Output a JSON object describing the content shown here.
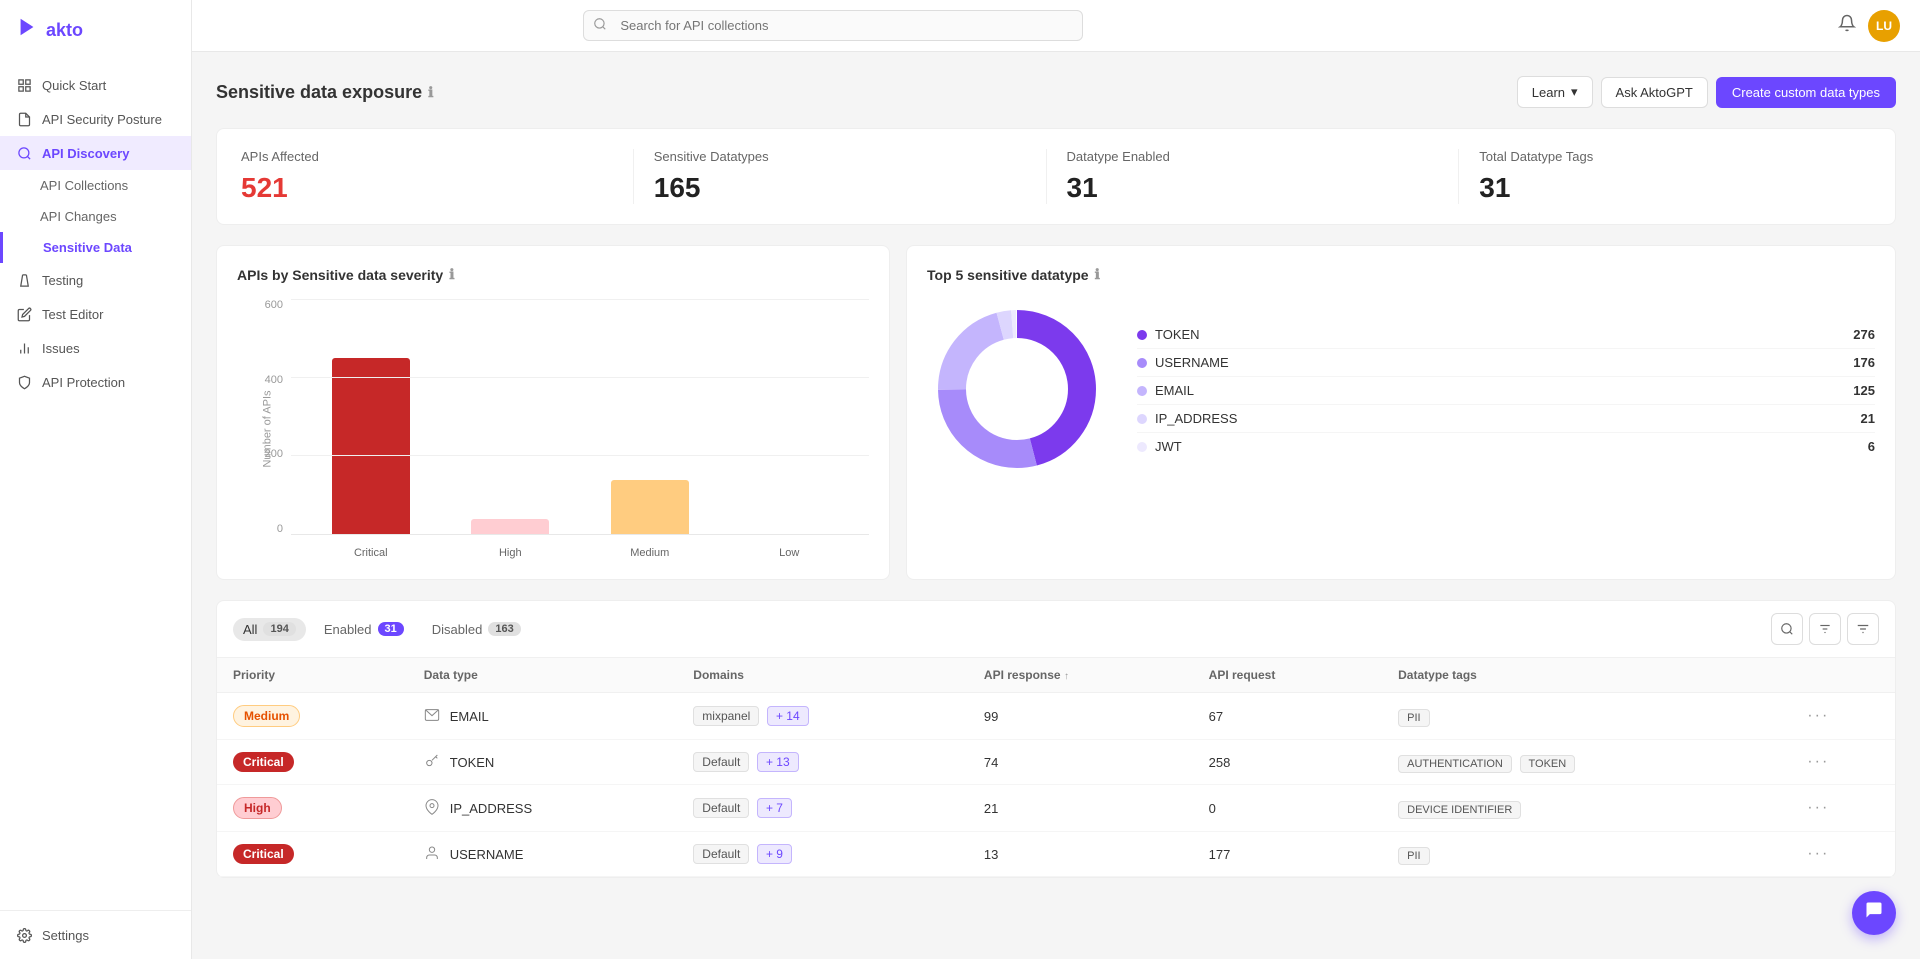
{
  "app": {
    "name": "akto",
    "logo_icon": "▶",
    "avatar_initials": "LU",
    "avatar_bg": "#e8a000"
  },
  "search": {
    "placeholder": "Search for API collections"
  },
  "sidebar": {
    "items": [
      {
        "id": "quick-start",
        "label": "Quick Start",
        "icon": "grid"
      },
      {
        "id": "api-security-posture",
        "label": "API Security Posture",
        "icon": "file"
      },
      {
        "id": "api-discovery",
        "label": "API Discovery",
        "icon": "discovery",
        "active": true,
        "subitems": [
          {
            "id": "api-collections",
            "label": "API Collections"
          },
          {
            "id": "api-changes",
            "label": "API Changes"
          },
          {
            "id": "sensitive-data",
            "label": "Sensitive Data",
            "active": true
          }
        ]
      },
      {
        "id": "testing",
        "label": "Testing",
        "icon": "flask"
      },
      {
        "id": "test-editor",
        "label": "Test Editor",
        "icon": "edit"
      },
      {
        "id": "issues",
        "label": "Issues",
        "icon": "bar-chart"
      },
      {
        "id": "api-protection",
        "label": "API Protection",
        "icon": "shield"
      }
    ],
    "footer": {
      "label": "Settings",
      "icon": "gear"
    }
  },
  "page": {
    "title": "Sensitive data exposure",
    "actions": {
      "learn_label": "Learn",
      "akto_label": "Ask AktoGPT",
      "create_label": "Create custom data types"
    }
  },
  "stats": [
    {
      "id": "apis-affected",
      "label": "APIs Affected",
      "value": "521",
      "color": "red"
    },
    {
      "id": "sensitive-datatypes",
      "label": "Sensitive Datatypes",
      "value": "165",
      "color": "dark"
    },
    {
      "id": "datatype-enabled",
      "label": "Datatype Enabled",
      "value": "31",
      "color": "dark"
    },
    {
      "id": "total-datatype-tags",
      "label": "Total Datatype Tags",
      "value": "31",
      "color": "dark"
    }
  ],
  "bar_chart": {
    "title": "APIs by Sensitive data severity",
    "y_label": "Number of APIs",
    "y_ticks": [
      "0",
      "200",
      "400",
      "600"
    ],
    "bars": [
      {
        "label": "Critical",
        "value": 450,
        "max": 600,
        "color_class": "bar-critical"
      },
      {
        "label": "High",
        "value": 40,
        "max": 600,
        "color_class": "bar-high"
      },
      {
        "label": "Medium",
        "value": 140,
        "max": 600,
        "color_class": "bar-medium"
      },
      {
        "label": "Low",
        "value": 0,
        "max": 600,
        "color_class": "bar-low"
      }
    ]
  },
  "donut_chart": {
    "title": "Top 5 sensitive datatype",
    "segments": [
      {
        "name": "TOKEN",
        "value": 276,
        "color": "#7c3aed",
        "percent": 46
      },
      {
        "name": "USERNAME",
        "value": 176,
        "color": "#a78bfa",
        "percent": 29
      },
      {
        "name": "EMAIL",
        "value": 125,
        "color": "#c4b5fd",
        "percent": 21
      },
      {
        "name": "IP_ADDRESS",
        "value": 21,
        "color": "#ddd6fe",
        "percent": 3
      },
      {
        "name": "JWT",
        "value": 6,
        "color": "#ede9fe",
        "percent": 1
      }
    ]
  },
  "table": {
    "tabs": [
      {
        "id": "all",
        "label": "All",
        "count": "194",
        "active": true
      },
      {
        "id": "enabled",
        "label": "Enabled",
        "count": "31",
        "active": false
      },
      {
        "id": "disabled",
        "label": "Disabled",
        "count": "163",
        "active": false
      }
    ],
    "columns": [
      "Priority",
      "Data type",
      "Domains",
      "API response",
      "API request",
      "Datatype tags",
      ""
    ],
    "rows": [
      {
        "priority": "Medium",
        "priority_class": "priority-medium",
        "data_type": "EMAIL",
        "icon": "envelope",
        "domains": [
          {
            "label": "mixpanel"
          },
          {
            "label": "+14"
          }
        ],
        "api_response": "99",
        "api_request": "67",
        "tags": [
          "PII"
        ],
        "sort_indicator": false
      },
      {
        "priority": "Critical",
        "priority_class": "priority-critical",
        "data_type": "TOKEN",
        "icon": "key",
        "domains": [
          {
            "label": "Default"
          },
          {
            "label": "+13"
          }
        ],
        "api_response": "74",
        "api_request": "258",
        "tags": [
          "AUTHENTICATION",
          "TOKEN"
        ],
        "sort_indicator": false
      },
      {
        "priority": "High",
        "priority_class": "priority-high",
        "data_type": "IP_ADDRESS",
        "icon": "map-pin",
        "domains": [
          {
            "label": "Default"
          },
          {
            "label": "+7"
          }
        ],
        "api_response": "21",
        "api_request": "0",
        "tags": [
          "DEVICE IDENTIFIER"
        ],
        "sort_indicator": false
      },
      {
        "priority": "Critical",
        "priority_class": "priority-critical",
        "data_type": "USERNAME",
        "icon": "user",
        "domains": [
          {
            "label": "Default"
          },
          {
            "label": "+9"
          }
        ],
        "api_response": "13",
        "api_request": "177",
        "tags": [
          "PII"
        ],
        "sort_indicator": false
      }
    ]
  }
}
